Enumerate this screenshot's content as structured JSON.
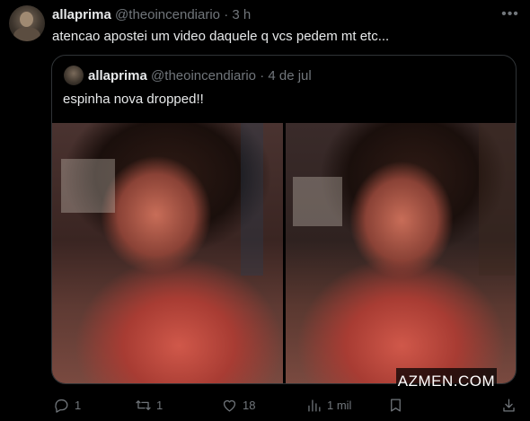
{
  "tweet": {
    "author_name": "allaprima",
    "author_handle": "@theoincendiario",
    "separator": "·",
    "time": "3 h",
    "text": "atencao apostei um video daquele q vcs pedem mt etc...",
    "more_icon": "ellipsis-icon"
  },
  "quote": {
    "author_name": "allaprima",
    "author_handle": "@theoincendiario",
    "separator": "·",
    "date": "4 de jul",
    "text": "espinha nova dropped!!"
  },
  "watermark": "AZMEN.COM",
  "actions": {
    "replies": "1",
    "reposts": "1",
    "likes": "18",
    "views": "1 mil"
  },
  "colors": {
    "background": "#000000",
    "text": "#e7e9ea",
    "muted": "#71767b",
    "border": "#2f3336"
  }
}
